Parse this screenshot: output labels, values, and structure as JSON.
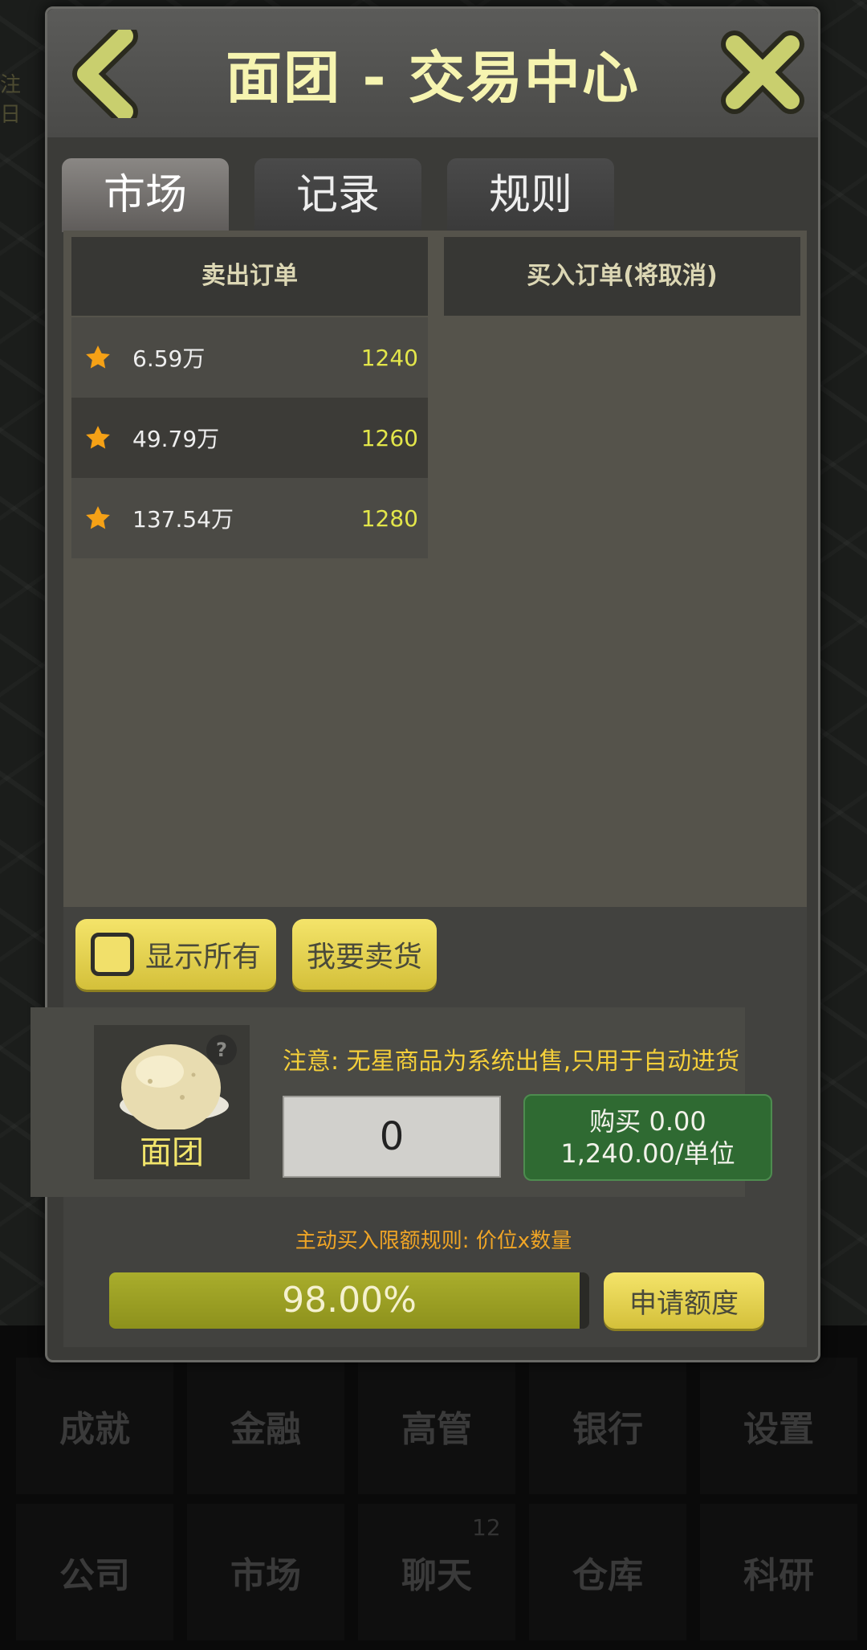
{
  "dialog": {
    "title": "面团 - 交易中心",
    "tabs": [
      "市场",
      "记录",
      "规则"
    ],
    "active_tab": "市场"
  },
  "market": {
    "sell_header": "卖出订单",
    "buy_header": "买入订单(将取消)",
    "sell_orders": [
      {
        "qty": "6.59万",
        "price": "1240"
      },
      {
        "qty": "49.79万",
        "price": "1260"
      },
      {
        "qty": "137.54万",
        "price": "1280"
      }
    ]
  },
  "actions": {
    "show_all": "显示所有",
    "sell_goods": "我要卖货",
    "show_all_checked": false
  },
  "item": {
    "name": "面团",
    "help": "?",
    "notice": "注意: 无星商品为系统出售,只用于自动进货",
    "quantity": "0",
    "buy_line1": "购买 0.00",
    "buy_line2": "1,240.00/单位"
  },
  "quota": {
    "rule": "主动买入限额规则: 价位x数量",
    "progress_label": "98.00%",
    "progress_value": 0.98,
    "apply_button": "申请额度"
  },
  "background": {
    "side_text": "注日",
    "nav_row1": [
      "成就",
      "金融",
      "高管",
      "银行",
      "设置"
    ],
    "nav_row2": [
      "公司",
      "市场",
      "聊天",
      "仓库",
      "科研"
    ],
    "chat_badge": "12"
  },
  "colors": {
    "title": "#f6f4b0",
    "price": "#e3e64a",
    "accent_yellow": "#f1e06a",
    "buy_green": "#2f6a32",
    "rule_orange": "#f0a526"
  }
}
